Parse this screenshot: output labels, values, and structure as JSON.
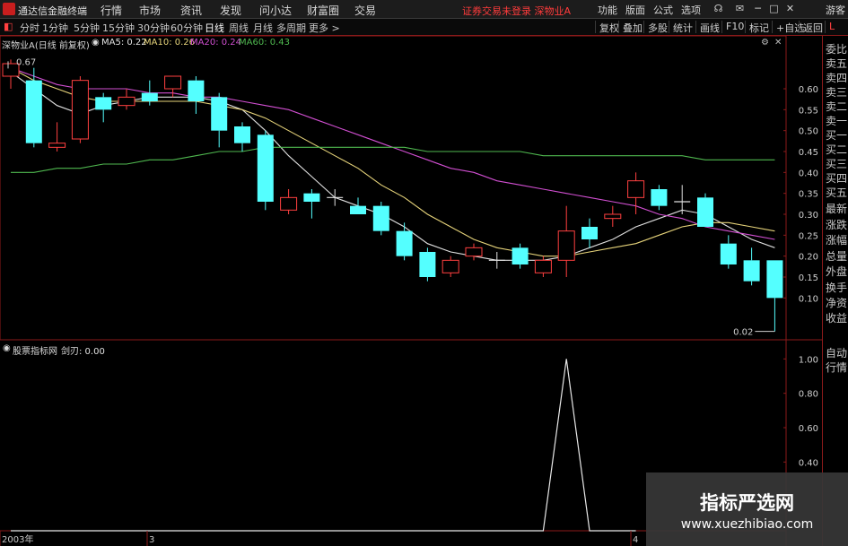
{
  "topbar": {
    "app_name": "通达信金融终端",
    "menu": [
      "行情",
      "市场",
      "资讯",
      "发现",
      "问小达",
      "财富圈",
      "交易"
    ],
    "status": "证券交易未登录  深物业A",
    "right_menu": [
      "功能",
      "版面",
      "公式",
      "选项"
    ],
    "guest": "游客"
  },
  "periods": [
    "分时",
    "1分钟",
    "5分钟",
    "15分钟",
    "30分钟",
    "60分钟",
    "日线",
    "周线",
    "月线",
    "多周期",
    "更多 >"
  ],
  "active_period": "日线",
  "tools": [
    "复权",
    "叠加",
    "多股",
    "统计",
    "画线",
    "F10",
    "标记",
    "+自选",
    "返回"
  ],
  "side_labels": [
    "L",
    "委比",
    "卖五",
    "卖四",
    "卖三",
    "卖二",
    "卖一",
    "买一",
    "买二",
    "买三",
    "买四",
    "买五",
    "最新",
    "涨跌",
    "涨幅",
    "总量",
    "外盘",
    "换手",
    "净资",
    "收益",
    "自动",
    "行情"
  ],
  "main_legend": {
    "title": "深物业A(日线 前复权)",
    "ma": [
      {
        "label": "MA5: 0.22",
        "color": "#e0e0e0"
      },
      {
        "label": "MA10: 0.26",
        "color": "#e6d37a"
      },
      {
        "label": "MA20: 0.24",
        "color": "#d24fd2"
      },
      {
        "label": "MA60: 0.43",
        "color": "#4fb84f"
      }
    ]
  },
  "sub_legend": {
    "title": "股票指标网",
    "value": "剑刃: 0.00"
  },
  "axis": {
    "x_labels": [
      "2003年",
      "3",
      "4"
    ]
  },
  "colors": {
    "up": "#ff4040",
    "down": "#54ffff",
    "grid": "#8b1a1a"
  },
  "chart_data": {
    "type": "candlestick",
    "y_ticks": [
      0.6,
      0.55,
      0.5,
      0.45,
      0.4,
      0.35,
      0.3,
      0.25,
      0.2,
      0.15,
      0.1
    ],
    "ylim": [
      0.0,
      0.69
    ],
    "annotations": [
      {
        "text": "0.67",
        "bar": 0,
        "value": 0.67
      },
      {
        "text": "0.02",
        "bar": 33,
        "value": 0.02
      }
    ],
    "candles": [
      {
        "o": 0.63,
        "c": 0.66,
        "h": 0.67,
        "l": 0.6
      },
      {
        "o": 0.62,
        "c": 0.47,
        "h": 0.65,
        "l": 0.46
      },
      {
        "o": 0.46,
        "c": 0.47,
        "h": 0.52,
        "l": 0.45
      },
      {
        "o": 0.48,
        "c": 0.62,
        "h": 0.63,
        "l": 0.47
      },
      {
        "o": 0.58,
        "c": 0.55,
        "h": 0.59,
        "l": 0.52
      },
      {
        "o": 0.56,
        "c": 0.58,
        "h": 0.6,
        "l": 0.55
      },
      {
        "o": 0.59,
        "c": 0.57,
        "h": 0.62,
        "l": 0.56
      },
      {
        "o": 0.6,
        "c": 0.63,
        "h": 0.63,
        "l": 0.58
      },
      {
        "o": 0.62,
        "c": 0.57,
        "h": 0.63,
        "l": 0.54
      },
      {
        "o": 0.58,
        "c": 0.5,
        "h": 0.59,
        "l": 0.46
      },
      {
        "o": 0.51,
        "c": 0.47,
        "h": 0.52,
        "l": 0.45
      },
      {
        "o": 0.49,
        "c": 0.33,
        "h": 0.5,
        "l": 0.31
      },
      {
        "o": 0.31,
        "c": 0.34,
        "h": 0.36,
        "l": 0.3
      },
      {
        "o": 0.35,
        "c": 0.33,
        "h": 0.36,
        "l": 0.29
      },
      {
        "o": 0.34,
        "c": 0.34,
        "h": 0.36,
        "l": 0.32
      },
      {
        "o": 0.32,
        "c": 0.3,
        "h": 0.34,
        "l": 0.3
      },
      {
        "o": 0.32,
        "c": 0.26,
        "h": 0.33,
        "l": 0.25
      },
      {
        "o": 0.26,
        "c": 0.2,
        "h": 0.28,
        "l": 0.19
      },
      {
        "o": 0.21,
        "c": 0.15,
        "h": 0.22,
        "l": 0.14
      },
      {
        "o": 0.16,
        "c": 0.19,
        "h": 0.2,
        "l": 0.15
      },
      {
        "o": 0.2,
        "c": 0.22,
        "h": 0.23,
        "l": 0.19
      },
      {
        "o": 0.19,
        "c": 0.19,
        "h": 0.21,
        "l": 0.17
      },
      {
        "o": 0.22,
        "c": 0.18,
        "h": 0.23,
        "l": 0.17
      },
      {
        "o": 0.16,
        "c": 0.19,
        "h": 0.2,
        "l": 0.15
      },
      {
        "o": 0.19,
        "c": 0.26,
        "h": 0.32,
        "l": 0.15
      },
      {
        "o": 0.27,
        "c": 0.24,
        "h": 0.29,
        "l": 0.22
      },
      {
        "o": 0.29,
        "c": 0.3,
        "h": 0.32,
        "l": 0.27
      },
      {
        "o": 0.34,
        "c": 0.38,
        "h": 0.4,
        "l": 0.3
      },
      {
        "o": 0.36,
        "c": 0.32,
        "h": 0.37,
        "l": 0.31
      },
      {
        "o": 0.33,
        "c": 0.33,
        "h": 0.37,
        "l": 0.3
      },
      {
        "o": 0.34,
        "c": 0.27,
        "h": 0.35,
        "l": 0.27
      },
      {
        "o": 0.23,
        "c": 0.18,
        "h": 0.25,
        "l": 0.17
      },
      {
        "o": 0.19,
        "c": 0.14,
        "h": 0.22,
        "l": 0.13
      },
      {
        "o": 0.19,
        "c": 0.1,
        "h": 0.19,
        "l": 0.02
      }
    ],
    "ma_series": [
      {
        "name": "MA5",
        "color": "#e0e0e0",
        "values": [
          0.64,
          0.6,
          0.56,
          0.54,
          0.56,
          0.57,
          0.58,
          0.58,
          0.58,
          0.57,
          0.55,
          0.5,
          0.44,
          0.39,
          0.34,
          0.32,
          0.3,
          0.27,
          0.23,
          0.21,
          0.2,
          0.19,
          0.19,
          0.19,
          0.2,
          0.22,
          0.24,
          0.27,
          0.29,
          0.31,
          0.3,
          0.27,
          0.24,
          0.22
        ]
      },
      {
        "name": "MA10",
        "color": "#e6d37a",
        "values": [
          0.65,
          0.62,
          0.6,
          0.58,
          0.57,
          0.57,
          0.57,
          0.57,
          0.57,
          0.56,
          0.55,
          0.53,
          0.5,
          0.47,
          0.44,
          0.41,
          0.37,
          0.34,
          0.3,
          0.27,
          0.24,
          0.22,
          0.21,
          0.2,
          0.2,
          0.21,
          0.22,
          0.23,
          0.25,
          0.27,
          0.28,
          0.28,
          0.27,
          0.26
        ]
      },
      {
        "name": "MA20",
        "color": "#d24fd2",
        "values": [
          0.65,
          0.63,
          0.61,
          0.6,
          0.6,
          0.6,
          0.59,
          0.59,
          0.58,
          0.58,
          0.57,
          0.56,
          0.55,
          0.53,
          0.51,
          0.49,
          0.47,
          0.45,
          0.43,
          0.41,
          0.4,
          0.38,
          0.37,
          0.36,
          0.35,
          0.34,
          0.33,
          0.32,
          0.3,
          0.29,
          0.27,
          0.26,
          0.25,
          0.24
        ]
      },
      {
        "name": "MA60",
        "color": "#4fb84f",
        "values": [
          0.4,
          0.4,
          0.41,
          0.41,
          0.42,
          0.42,
          0.43,
          0.43,
          0.44,
          0.45,
          0.45,
          0.46,
          0.46,
          0.46,
          0.46,
          0.46,
          0.46,
          0.46,
          0.45,
          0.45,
          0.45,
          0.45,
          0.45,
          0.44,
          0.44,
          0.44,
          0.44,
          0.44,
          0.44,
          0.44,
          0.43,
          0.43,
          0.43,
          0.43
        ]
      }
    ],
    "indicator": {
      "y_ticks": [
        1.0,
        0.8,
        0.6,
        0.4
      ],
      "ylim": [
        0.0,
        1.08
      ],
      "series": [
        {
          "bar": 0,
          "value": 0.0
        },
        {
          "bar": 23,
          "value": 0.0
        },
        {
          "bar": 24,
          "value": 1.0
        },
        {
          "bar": 25,
          "value": 0.0
        },
        {
          "bar": 27,
          "value": 0.0
        }
      ]
    }
  },
  "watermark": {
    "title": "指标严选网",
    "url": "www.xuezhibiao.com"
  }
}
